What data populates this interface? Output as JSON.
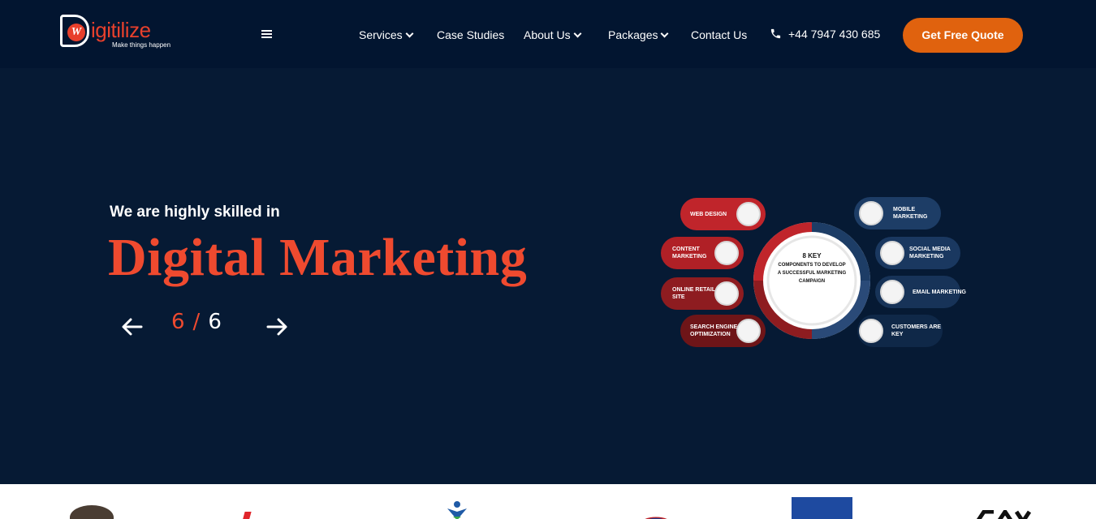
{
  "header": {
    "logo_text": "igitilize",
    "logo_letter": "W",
    "logo_tagline": "Make things happen",
    "nav": [
      {
        "label": "Services",
        "dropdown": true
      },
      {
        "label": "Case Studies",
        "dropdown": false
      },
      {
        "label": "About Us",
        "dropdown": true
      },
      {
        "label": "Packages",
        "dropdown": true
      },
      {
        "label": "Contact Us",
        "dropdown": false
      }
    ],
    "phone": "+44 7947 430 685",
    "cta_label": "Get Free Quote"
  },
  "hero": {
    "subtitle": "We are highly skilled in",
    "title": "Digital Marketing",
    "slide_current": "6",
    "slide_separator": "/",
    "slide_total": "6"
  },
  "infographic": {
    "center_line1": "8 KEY",
    "center_line2": "COMPONENTS TO DEVELOP A SUCCESSFUL MARKETING CAMPAIGN",
    "left_items": [
      "WEB DESIGN",
      "CONTENT MARKETING",
      "ONLINE RETAIL SITE",
      "SEARCH ENGINE OPTIMIZATION"
    ],
    "right_items": [
      "MOBILE MARKETING",
      "SOCIAL MEDIA MARKETING",
      "EMAIL MARKETING",
      "CUSTOMERS ARE KEY"
    ]
  },
  "colors": {
    "background": "#061a34",
    "header": "#021530",
    "accent": "#ef4a2f",
    "cta": "#e0620e"
  }
}
